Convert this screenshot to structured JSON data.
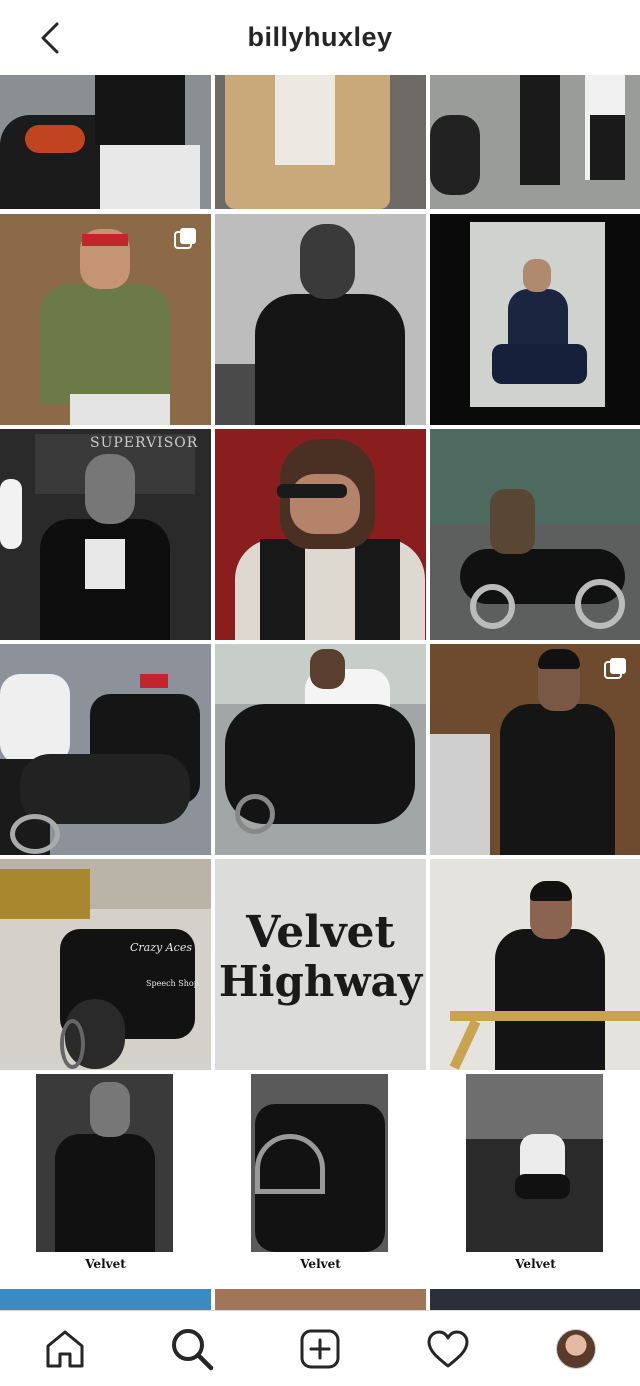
{
  "header": {
    "username": "billyhuxley"
  },
  "grid": {
    "velvet_poster": {
      "line1": "Velvet",
      "line2": "Highway"
    },
    "small_caption": "Velvet",
    "supervisor_sign": "SUPERVISOR",
    "jacket_text": "Crazy Aces",
    "jacket_sub": "Speech Shop"
  },
  "nav": [
    "home-icon",
    "search-icon",
    "new-post-icon",
    "activity-heart-icon",
    "profile-avatar"
  ]
}
